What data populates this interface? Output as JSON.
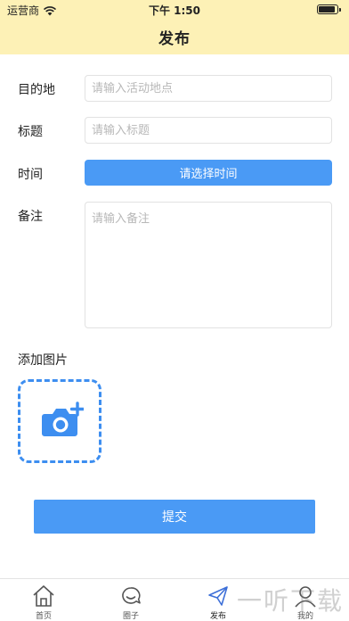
{
  "status_bar": {
    "carrier": "运营商",
    "time": "下午 1:50"
  },
  "header": {
    "title": "发布"
  },
  "form": {
    "destination": {
      "label": "目的地",
      "placeholder": "请输入活动地点"
    },
    "title": {
      "label": "标题",
      "placeholder": "请输入标题"
    },
    "time": {
      "label": "时间",
      "button": "请选择时间"
    },
    "note": {
      "label": "备注",
      "placeholder": "请输入备注"
    },
    "image": {
      "label": "添加图片"
    }
  },
  "submit_label": "提交",
  "tab_bar": {
    "items": [
      {
        "label": "首页",
        "icon": "home-icon"
      },
      {
        "label": "圈子",
        "icon": "chat-icon"
      },
      {
        "label": "发布",
        "icon": "send-icon",
        "active": true
      },
      {
        "label": "我的",
        "icon": "user-icon"
      }
    ]
  },
  "watermark": "一听下载",
  "colors": {
    "header_bg": "#fdf1b6",
    "accent": "#4a9af5",
    "upload_border": "#3d8ef0"
  }
}
